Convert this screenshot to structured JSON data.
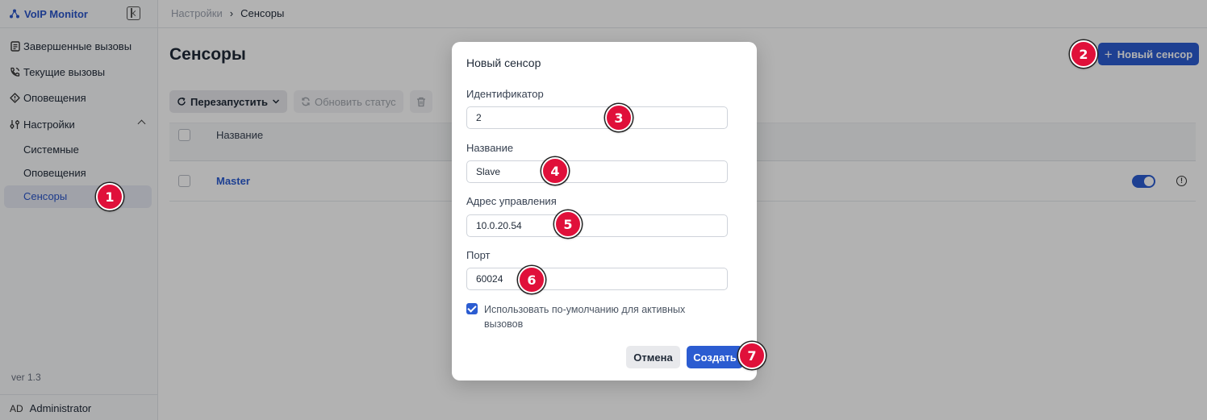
{
  "sidebar": {
    "brand": "VoIP Monitor",
    "items": [
      {
        "label": "Завершенные вызовы",
        "icon": "document-icon"
      },
      {
        "label": "Текущие вызовы",
        "icon": "phone-icon"
      },
      {
        "label": "Оповещения",
        "icon": "alert-icon"
      },
      {
        "label": "Настройки",
        "icon": "sliders-icon"
      }
    ],
    "sub_items": [
      {
        "label": "Системные"
      },
      {
        "label": "Оповещения"
      },
      {
        "label": "Сенсоры"
      }
    ],
    "version": "ver 1.3",
    "user": {
      "initials": "AD",
      "name": "Administrator"
    }
  },
  "breadcrumb": {
    "parent": "Настройки",
    "sep": "›",
    "current": "Сенсоры"
  },
  "page": {
    "title": "Сенсоры",
    "new_button": "Новый сенсор",
    "new_button_plus": "+"
  },
  "toolbar": {
    "restart": "Перезапустить",
    "update_status": "Обновить статус"
  },
  "table": {
    "header_name": "Название",
    "rows": [
      {
        "name": "Master",
        "enabled": true
      }
    ]
  },
  "modal": {
    "title": "Новый сенсор",
    "fields": {
      "id": {
        "label": "Идентификатор",
        "value": "2"
      },
      "name": {
        "label": "Название",
        "value": "Slave"
      },
      "address": {
        "label": "Адрес управления",
        "value": "10.0.20.54"
      },
      "port": {
        "label": "Порт",
        "value": "60024"
      }
    },
    "checkbox": {
      "label": "Использовать по-умолчанию для активных вызовов",
      "checked": true
    },
    "cancel": "Отмена",
    "create": "Создать"
  },
  "steps": [
    "1",
    "2",
    "3",
    "4",
    "5",
    "6",
    "7"
  ],
  "colors": {
    "accent": "#2b5cd1",
    "badge": "#e0103a"
  }
}
